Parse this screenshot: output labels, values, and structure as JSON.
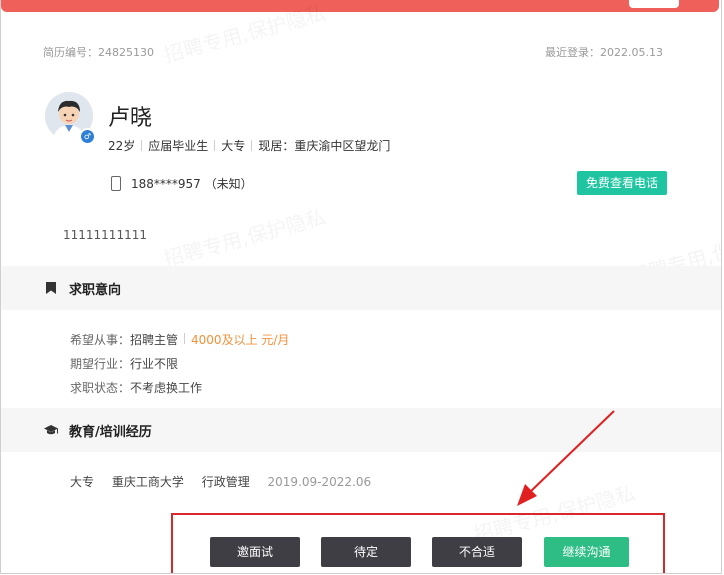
{
  "resume": {
    "id_label": "简历编号：24825130",
    "last_login_label": "最近登录：2022.05.13"
  },
  "profile": {
    "name": "卢晓",
    "age": "22岁",
    "status": "应届毕业生",
    "education": "大专",
    "location": "现居：重庆渝中区望龙门",
    "phone": "188****957 （未知）",
    "view_phone_button": "免费查看电话",
    "note": "11111111111"
  },
  "watermark": {
    "text": "招聘专用,保护隐私"
  },
  "job_intention": {
    "title": "求职意向",
    "desired_position_label": "希望从事：",
    "desired_position": "招聘主管",
    "salary": "4000及以上 元/月",
    "industry_label": "期望行业：",
    "industry": "行业不限",
    "job_status_label": "求职状态：",
    "job_status": "不考虑换工作"
  },
  "education": {
    "title": "教育/培训经历",
    "degree": "大专",
    "school": "重庆工商大学",
    "major": "行政管理",
    "period": "2019.09-2022.06"
  },
  "actions": {
    "interview": "邀面试",
    "pending": "待定",
    "unsuitable": "不合适",
    "continue_chat": "继续沟通"
  },
  "colors": {
    "accent_green": "#1ec5a0",
    "salary_orange": "#f3913c",
    "highlight_red": "#d9282a",
    "top_bar_red": "#f0605a"
  },
  "icons": {
    "avatar": "cartoon-boy-avatar",
    "gender": "male-icon",
    "phone": "phone-icon",
    "job_intention": "bookmark-icon",
    "education": "graduation-cap-icon",
    "annotation": "red-arrow"
  }
}
